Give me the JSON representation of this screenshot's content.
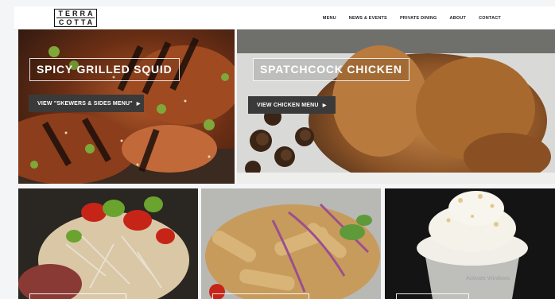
{
  "header": {
    "logo_line1": "TERRA",
    "logo_line2": "COTTA",
    "nav": {
      "menu": "MENU",
      "news_events": "NEWS & EVENTS",
      "private_dining": "PRIVATE DINING",
      "about": "ABOUT",
      "contact": "CONTACT"
    }
  },
  "tiles": {
    "squid": {
      "title": "SPICY GRILLED SQUID",
      "button": "VIEW \"SKEWERS & SIDES MENU\""
    },
    "chicken": {
      "title": "SPATCHCOCK CHICKEN",
      "button": "VIEW CHICKEN MENU"
    }
  },
  "icons": {
    "button_chevron": "chevron-right-icon"
  },
  "colors": {
    "button_bg": "#3a3a3a",
    "header_bg": "#ffffff"
  },
  "watermark": "Activate Windows"
}
